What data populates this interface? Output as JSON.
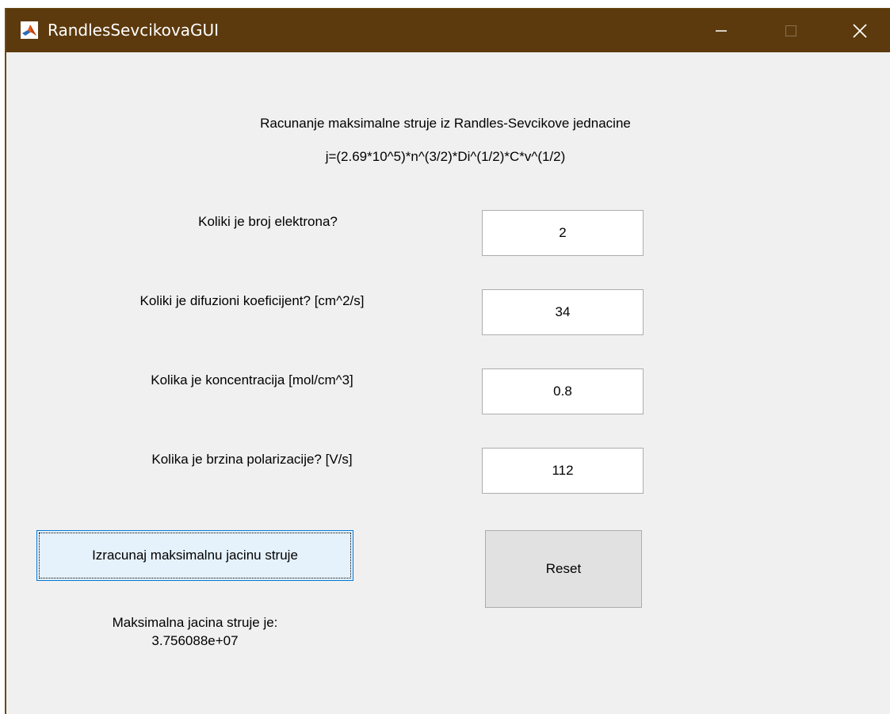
{
  "window": {
    "title": "RandlesSevcikovaGUI",
    "app_icon": "matlab-icon",
    "controls": {
      "minimize": "minimize-icon",
      "maximize": "maximize-icon",
      "close": "close-icon"
    },
    "titlebar_color": "#5c3a0d"
  },
  "header": {
    "title": "Racunanje maksimalne struje iz Randles-Sevcikove jednacine",
    "formula": "j=(2.69*10^5)*n^(3/2)*Di^(1/2)*C*v^(1/2)"
  },
  "inputs": [
    {
      "label": "Koliki je broj elektrona?",
      "value": "2"
    },
    {
      "label": "Koliki je difuzioni koeficijent? [cm^2/s]",
      "value": "34"
    },
    {
      "label": "Kolika je koncentracija [mol/cm^3]",
      "value": "0.8"
    },
    {
      "label": "Kolika je brzina polarizacije? [V/s]",
      "value": "112"
    }
  ],
  "buttons": {
    "calculate": "Izracunaj maksimalnu jacinu struje",
    "reset": "Reset"
  },
  "result": {
    "label": "Maksimalna jacina struje je:",
    "value": "3.756088e+07"
  }
}
